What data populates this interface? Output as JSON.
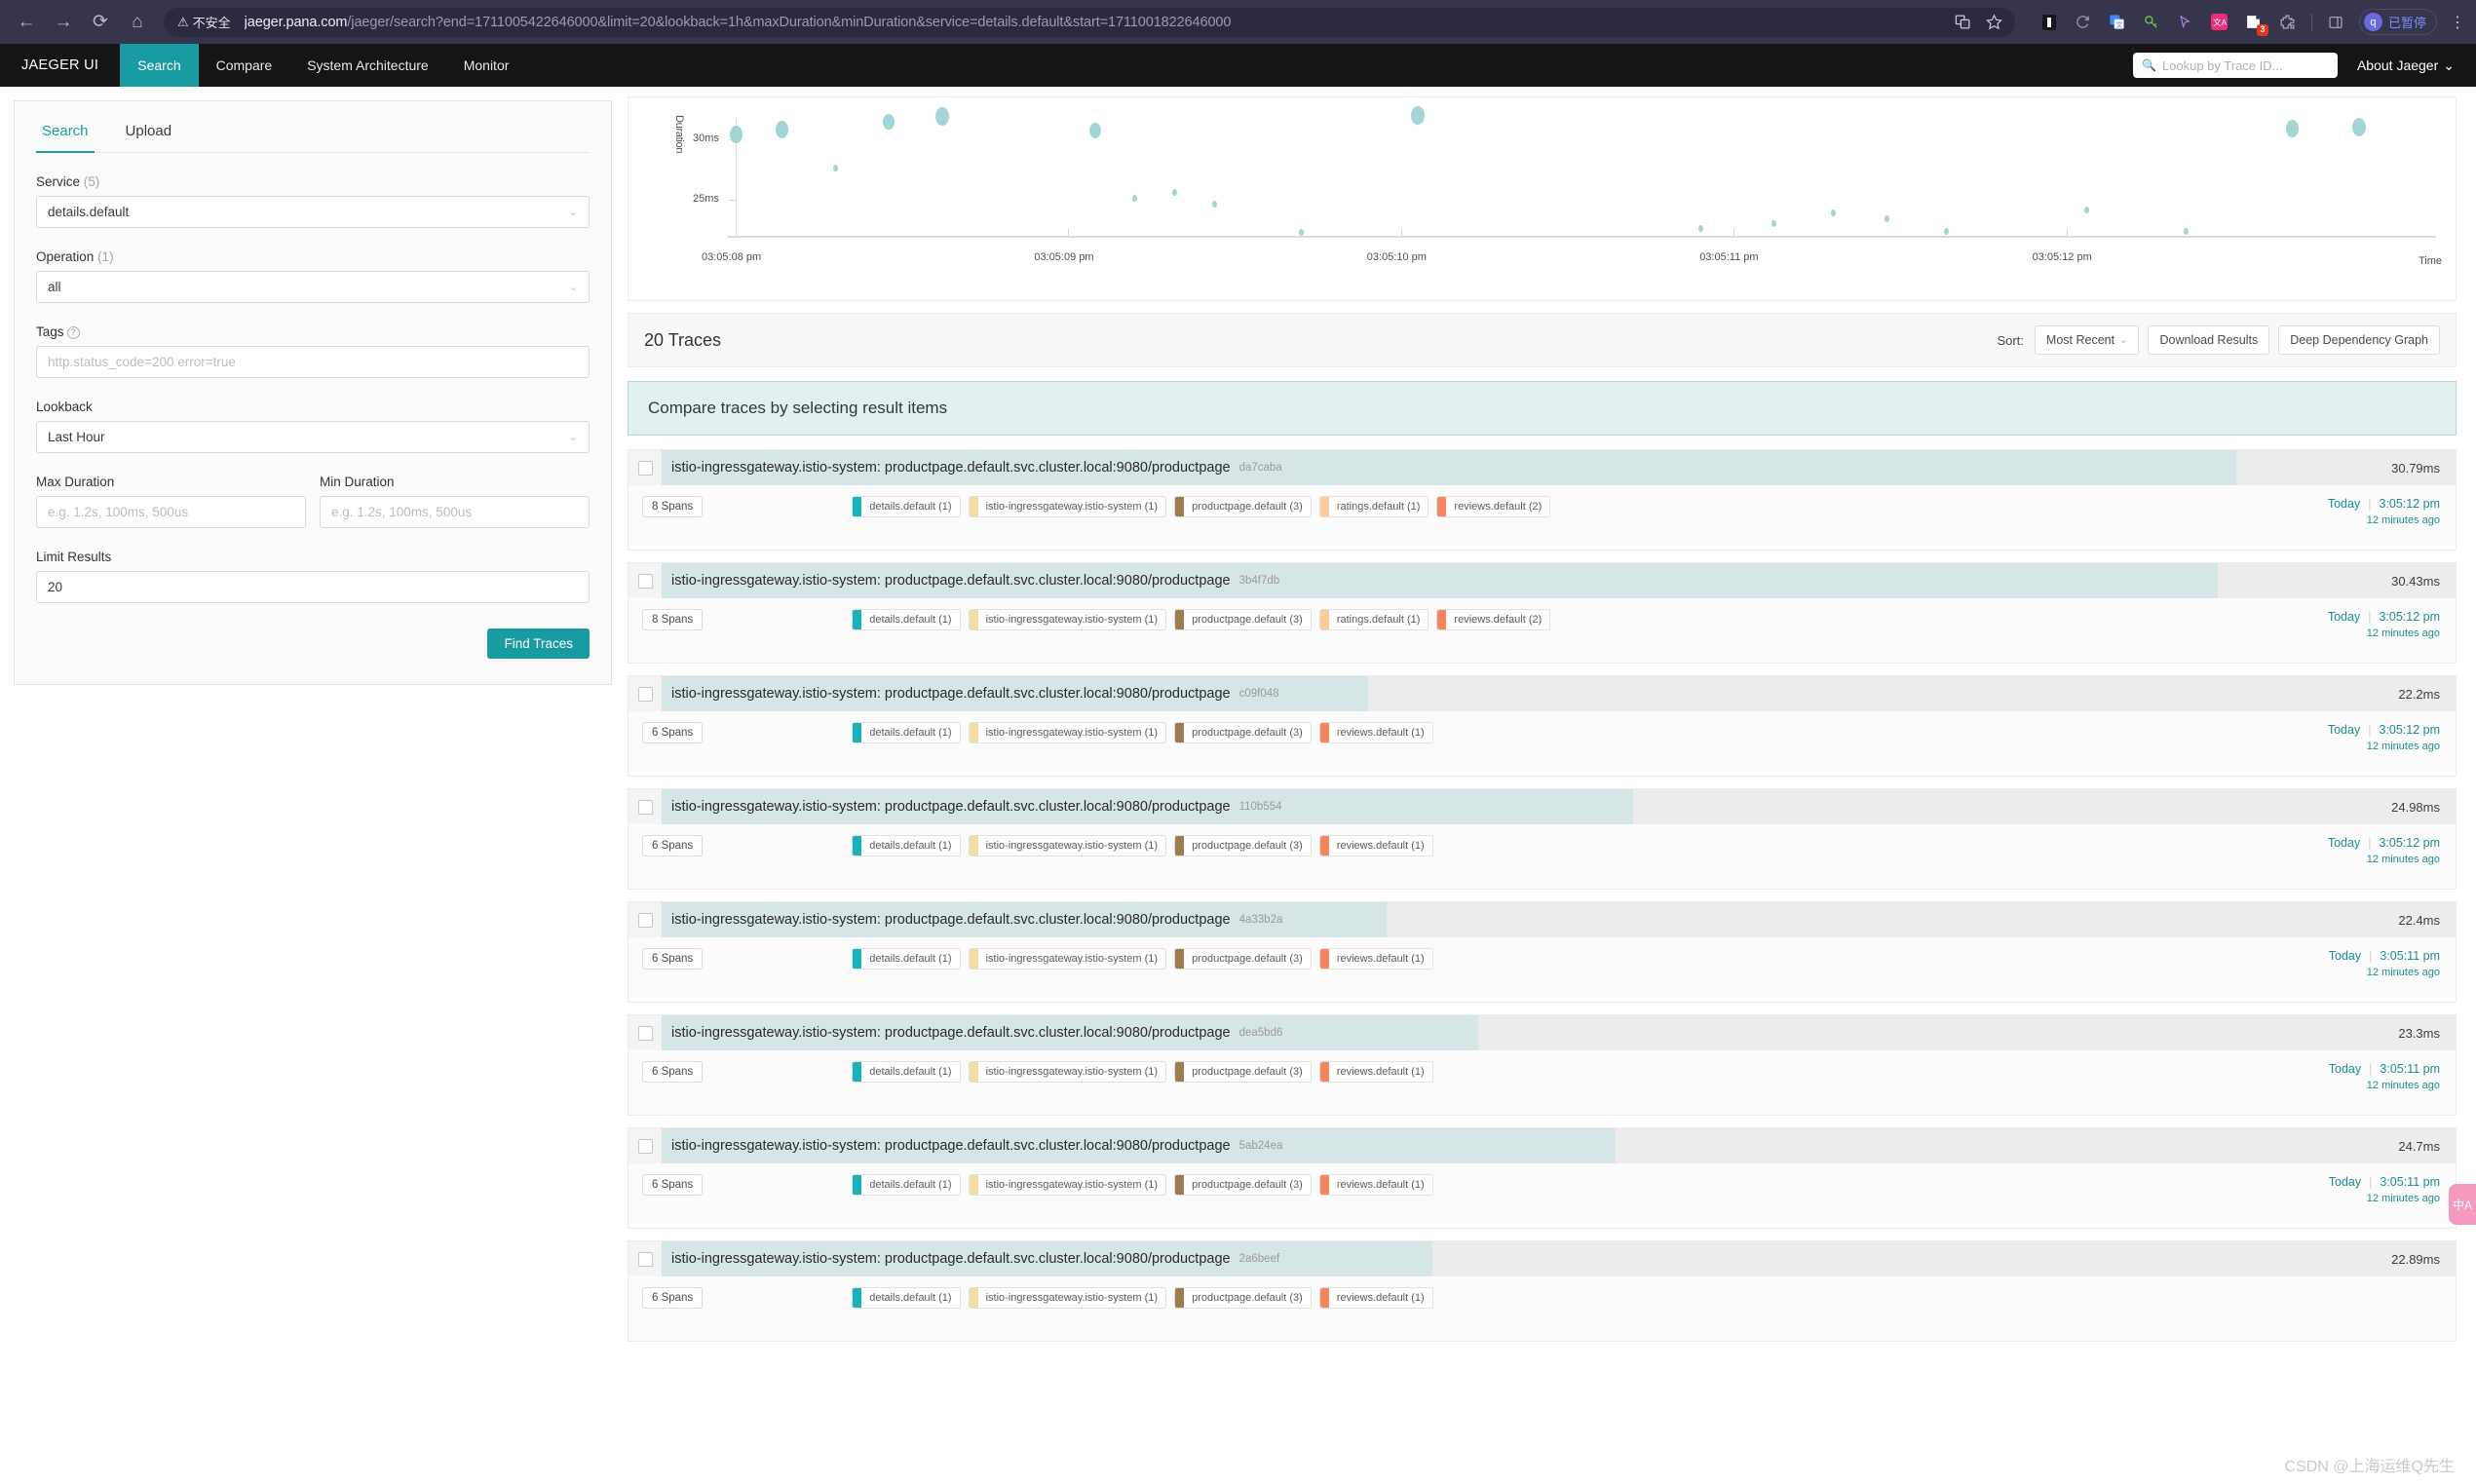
{
  "browser": {
    "nav": {
      "back": "←",
      "forward": "→",
      "reload": "⟳",
      "home": "⌂"
    },
    "security_label": "不安全",
    "security_icon": "⚠",
    "url_host": "jaeger.pana.com",
    "url_path": "/jaeger/search?end=1711005422646000&limit=20&lookback=1h&maxDuration&minDuration&service=details.default&start=1711001822646000",
    "extensions": [
      "translate-icon",
      "bookmark-star-icon",
      "reader-icon",
      "history-icon",
      "translate-doc-icon",
      "key-icon",
      "cursor-icon",
      "language-icon",
      "notes-icon",
      "puzzle-icon",
      "divider",
      "sidepanel-icon"
    ],
    "profile_initial": "q",
    "profile_status": "已暂停",
    "menu_icon": "⋮"
  },
  "header": {
    "brand": "JAEGER UI",
    "nav_items": [
      {
        "label": "Search",
        "active": true
      },
      {
        "label": "Compare",
        "active": false
      },
      {
        "label": "System Architecture",
        "active": false
      },
      {
        "label": "Monitor",
        "active": false
      }
    ],
    "lookup_placeholder": "Lookup by Trace ID...",
    "about_label": "About Jaeger"
  },
  "sidebar": {
    "tabs": [
      {
        "label": "Search",
        "active": true
      },
      {
        "label": "Upload",
        "active": false
      }
    ],
    "service": {
      "label": "Service",
      "count": "(5)",
      "value": "details.default"
    },
    "operation": {
      "label": "Operation",
      "count": "(1)",
      "value": "all"
    },
    "tags": {
      "label": "Tags",
      "placeholder": "http.status_code=200 error=true",
      "value": ""
    },
    "lookback": {
      "label": "Lookback",
      "value": "Last Hour"
    },
    "max_duration": {
      "label": "Max Duration",
      "placeholder": "e.g. 1.2s, 100ms, 500us",
      "value": ""
    },
    "min_duration": {
      "label": "Min Duration",
      "placeholder": "e.g. 1.2s, 100ms, 500us",
      "value": ""
    },
    "limit_results": {
      "label": "Limit Results",
      "value": "20"
    },
    "find_button": "Find Traces"
  },
  "results": {
    "count_label": "20 Traces",
    "sort_label": "Sort:",
    "sort_value": "Most Recent",
    "download_label": "Download Results",
    "ddg_label": "Deep Dependency Graph",
    "compare_banner": "Compare traces by selecting result items"
  },
  "chart_data": {
    "type": "scatter",
    "title": "",
    "xlabel": "Time",
    "ylabel": "Duration",
    "grid": false,
    "legend": null,
    "xticks": [
      "03:05:08 pm",
      "03:05:09 pm",
      "03:05:10 pm",
      "03:05:11 pm",
      "03:05:12 pm"
    ],
    "yticks": [
      "25ms",
      "30ms"
    ],
    "ylim": [
      22,
      32
    ],
    "points": [
      {
        "x": "03:05:08.00 pm",
        "y": 30.4,
        "size": 13
      },
      {
        "x": "03:05:08.14 pm",
        "y": 30.8,
        "size": 13
      },
      {
        "x": "03:05:08.30 pm",
        "y": 27.6,
        "size": 5
      },
      {
        "x": "03:05:08.46 pm",
        "y": 31.4,
        "size": 12
      },
      {
        "x": "03:05:08.62 pm",
        "y": 31.9,
        "size": 14
      },
      {
        "x": "03:05:09.08 pm",
        "y": 30.7,
        "size": 12
      },
      {
        "x": "03:05:09.20 pm",
        "y": 25.1,
        "size": 5
      },
      {
        "x": "03:05:09.32 pm",
        "y": 25.6,
        "size": 5
      },
      {
        "x": "03:05:09.44 pm",
        "y": 24.6,
        "size": 5
      },
      {
        "x": "03:05:09.70 pm",
        "y": 22.3,
        "size": 5
      },
      {
        "x": "03:05:10.05 pm",
        "y": 32.0,
        "size": 14
      },
      {
        "x": "03:05:10.90 pm",
        "y": 22.6,
        "size": 5
      },
      {
        "x": "03:05:11.12 pm",
        "y": 23.0,
        "size": 5
      },
      {
        "x": "03:05:11.30 pm",
        "y": 23.9,
        "size": 5
      },
      {
        "x": "03:05:11.46 pm",
        "y": 23.4,
        "size": 5
      },
      {
        "x": "03:05:11.64 pm",
        "y": 22.4,
        "size": 5
      },
      {
        "x": "03:05:12.06 pm",
        "y": 24.1,
        "size": 5
      },
      {
        "x": "03:05:12.36 pm",
        "y": 22.4,
        "size": 5
      },
      {
        "x": "03:05:12.68 pm",
        "y": 30.9,
        "size": 13
      },
      {
        "x": "03:05:12.88 pm",
        "y": 31.0,
        "size": 14
      }
    ]
  },
  "service_colors": {
    "details.default": "#17b3b8",
    "istio-ingressgateway.istio-system": "#f2dda4",
    "productpage.default": "#a07b4d",
    "ratings.default": "#fbcb9c",
    "reviews.default": "#f8835f"
  },
  "traces": [
    {
      "name": "istio-ingressgateway.istio-system: productpage.default.svc.cluster.local:9080/productpage",
      "id": "da7caba",
      "duration": "30.79ms",
      "bar_pct": 88,
      "spans": "8 Spans",
      "services": [
        {
          "name": "details.default (1)",
          "color": "#17b3b8"
        },
        {
          "name": "istio-ingressgateway.istio-system (1)",
          "color": "#f2dda4"
        },
        {
          "name": "productpage.default (3)",
          "color": "#a07b4d"
        },
        {
          "name": "ratings.default (1)",
          "color": "#fbcb9c"
        },
        {
          "name": "reviews.default (2)",
          "color": "#f8835f"
        }
      ],
      "day": "Today",
      "time": "3:05:12 pm",
      "relative": "12 minutes ago"
    },
    {
      "name": "istio-ingressgateway.istio-system: productpage.default.svc.cluster.local:9080/productpage",
      "id": "3b4f7db",
      "duration": "30.43ms",
      "bar_pct": 87,
      "spans": "8 Spans",
      "services": [
        {
          "name": "details.default (1)",
          "color": "#17b3b8"
        },
        {
          "name": "istio-ingressgateway.istio-system (1)",
          "color": "#f2dda4"
        },
        {
          "name": "productpage.default (3)",
          "color": "#a07b4d"
        },
        {
          "name": "ratings.default (1)",
          "color": "#fbcb9c"
        },
        {
          "name": "reviews.default (2)",
          "color": "#f8835f"
        }
      ],
      "day": "Today",
      "time": "3:05:12 pm",
      "relative": "12 minutes ago"
    },
    {
      "name": "istio-ingressgateway.istio-system: productpage.default.svc.cluster.local:9080/productpage",
      "id": "c09f048",
      "duration": "22.2ms",
      "bar_pct": 40.5,
      "spans": "6 Spans",
      "services": [
        {
          "name": "details.default (1)",
          "color": "#17b3b8"
        },
        {
          "name": "istio-ingressgateway.istio-system (1)",
          "color": "#f2dda4"
        },
        {
          "name": "productpage.default (3)",
          "color": "#a07b4d"
        },
        {
          "name": "reviews.default (1)",
          "color": "#f8835f"
        }
      ],
      "day": "Today",
      "time": "3:05:12 pm",
      "relative": "12 minutes ago"
    },
    {
      "name": "istio-ingressgateway.istio-system: productpage.default.svc.cluster.local:9080/productpage",
      "id": "110b554",
      "duration": "24.98ms",
      "bar_pct": 55,
      "spans": "6 Spans",
      "services": [
        {
          "name": "details.default (1)",
          "color": "#17b3b8"
        },
        {
          "name": "istio-ingressgateway.istio-system (1)",
          "color": "#f2dda4"
        },
        {
          "name": "productpage.default (3)",
          "color": "#a07b4d"
        },
        {
          "name": "reviews.default (1)",
          "color": "#f8835f"
        }
      ],
      "day": "Today",
      "time": "3:05:12 pm",
      "relative": "12 minutes ago"
    },
    {
      "name": "istio-ingressgateway.istio-system: productpage.default.svc.cluster.local:9080/productpage",
      "id": "4a33b2a",
      "duration": "22.4ms",
      "bar_pct": 41.5,
      "spans": "6 Spans",
      "services": [
        {
          "name": "details.default (1)",
          "color": "#17b3b8"
        },
        {
          "name": "istio-ingressgateway.istio-system (1)",
          "color": "#f2dda4"
        },
        {
          "name": "productpage.default (3)",
          "color": "#a07b4d"
        },
        {
          "name": "reviews.default (1)",
          "color": "#f8835f"
        }
      ],
      "day": "Today",
      "time": "3:05:11 pm",
      "relative": "12 minutes ago"
    },
    {
      "name": "istio-ingressgateway.istio-system: productpage.default.svc.cluster.local:9080/productpage",
      "id": "dea5bd6",
      "duration": "23.3ms",
      "bar_pct": 46.5,
      "spans": "6 Spans",
      "services": [
        {
          "name": "details.default (1)",
          "color": "#17b3b8"
        },
        {
          "name": "istio-ingressgateway.istio-system (1)",
          "color": "#f2dda4"
        },
        {
          "name": "productpage.default (3)",
          "color": "#a07b4d"
        },
        {
          "name": "reviews.default (1)",
          "color": "#f8835f"
        }
      ],
      "day": "Today",
      "time": "3:05:11 pm",
      "relative": "12 minutes ago"
    },
    {
      "name": "istio-ingressgateway.istio-system: productpage.default.svc.cluster.local:9080/productpage",
      "id": "5ab24ea",
      "duration": "24.7ms",
      "bar_pct": 54,
      "spans": "6 Spans",
      "services": [
        {
          "name": "details.default (1)",
          "color": "#17b3b8"
        },
        {
          "name": "istio-ingressgateway.istio-system (1)",
          "color": "#f2dda4"
        },
        {
          "name": "productpage.default (3)",
          "color": "#a07b4d"
        },
        {
          "name": "reviews.default (1)",
          "color": "#f8835f"
        }
      ],
      "day": "Today",
      "time": "3:05:11 pm",
      "relative": "12 minutes ago"
    },
    {
      "name": "istio-ingressgateway.istio-system: productpage.default.svc.cluster.local:9080/productpage",
      "id": "2a6beef",
      "duration": "22.89ms",
      "bar_pct": 44,
      "spans": "6 Spans",
      "services": [
        {
          "name": "details.default (1)",
          "color": "#17b3b8"
        },
        {
          "name": "istio-ingressgateway.istio-system (1)",
          "color": "#f2dda4"
        },
        {
          "name": "productpage.default (3)",
          "color": "#a07b4d"
        },
        {
          "name": "reviews.default (1)",
          "color": "#f8835f"
        }
      ],
      "day": "",
      "time": "",
      "relative": ""
    }
  ],
  "overlay": {
    "translate_button": "中A",
    "watermark": "CSDN @上海运维Q先生"
  }
}
